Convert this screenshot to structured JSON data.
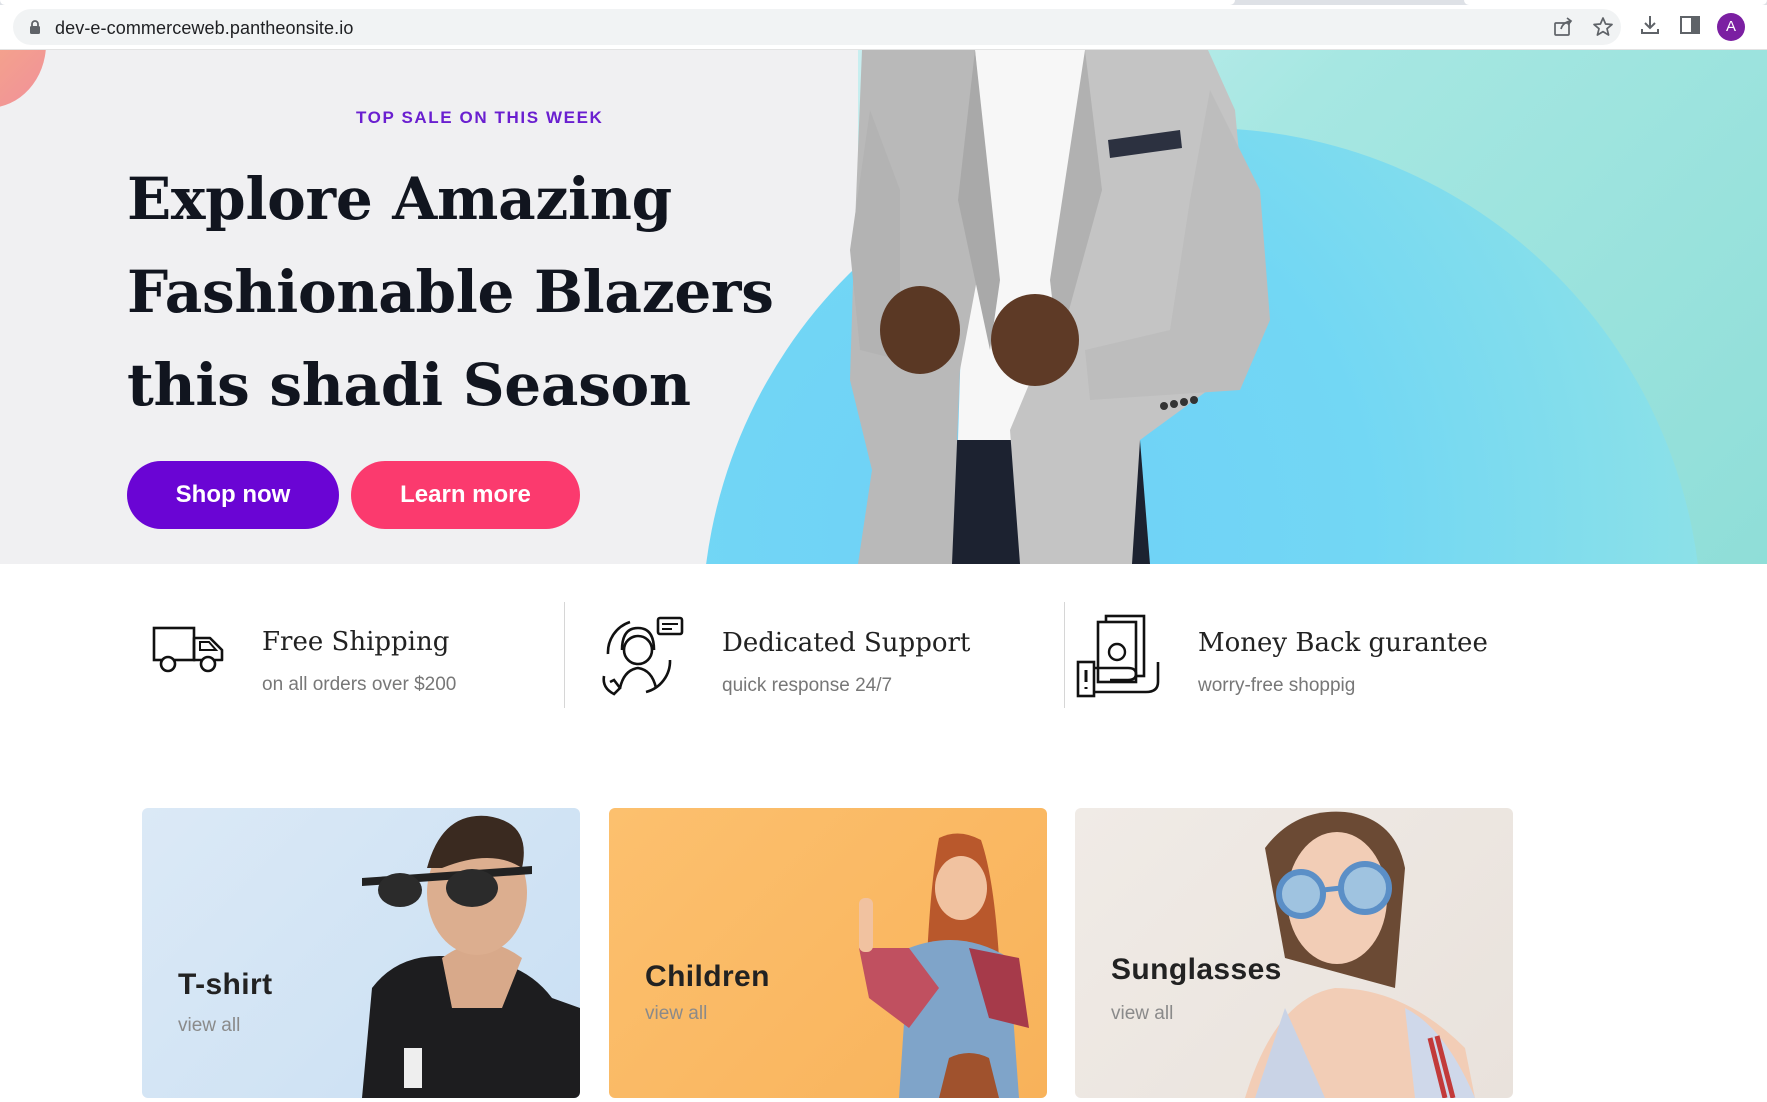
{
  "browser": {
    "url": "dev-e-commerceweb.pantheonsite.io",
    "avatar_letter": "A",
    "icons": [
      "lock-icon",
      "share-icon",
      "star-icon",
      "download-icon",
      "side-panel-icon"
    ]
  },
  "hero": {
    "eyebrow": "TOP SALE ON THIS WEEK",
    "title_line1": "Explore Amazing",
    "title_line2": "Fashionable Blazers",
    "title_line3": "this shadi Season",
    "shop_label": "Shop now",
    "learn_label": "Learn more",
    "colors": {
      "shop": "#6a05d4",
      "learn": "#fb3a6e",
      "eyebrow": "#6a1fd0"
    }
  },
  "features": [
    {
      "icon": "truck-icon",
      "title": "Free Shipping",
      "subtitle": "on all orders over $200"
    },
    {
      "icon": "support-agent-icon",
      "title": "Dedicated Support",
      "subtitle": "quick response 24/7"
    },
    {
      "icon": "money-back-icon",
      "title": "Money Back gurantee",
      "subtitle": "worry-free shoppig"
    }
  ],
  "categories": [
    {
      "title": "T-shirt",
      "link": "view all"
    },
    {
      "title": "Children",
      "link": "view all"
    },
    {
      "title": "Sunglasses",
      "link": "view all"
    }
  ]
}
